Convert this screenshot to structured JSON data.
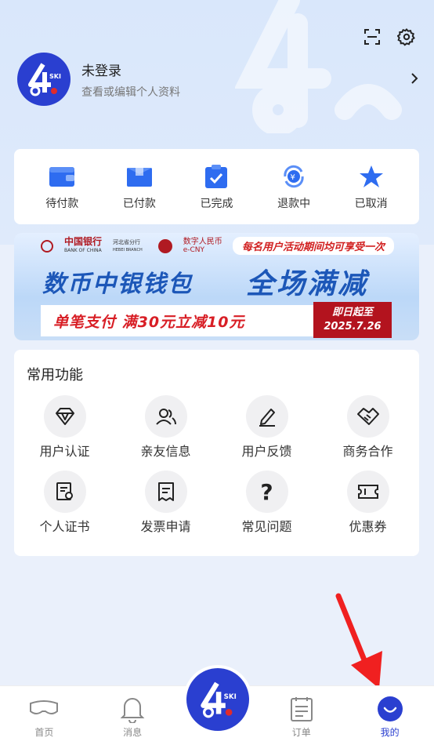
{
  "profile": {
    "name": "未登录",
    "subtitle": "查看或编辑个人资料"
  },
  "orders": [
    {
      "label": "待付款",
      "icon": "wallet-icon"
    },
    {
      "label": "已付款",
      "icon": "box-icon"
    },
    {
      "label": "已完成",
      "icon": "clipboard-check-icon"
    },
    {
      "label": "退款中",
      "icon": "refund-icon"
    },
    {
      "label": "已取消",
      "icon": "star-icon"
    }
  ],
  "banner": {
    "bank_cn": "中国银行",
    "bank_en": "BANK OF CHINA",
    "branch": "河北省分行",
    "branch_en": "HEBEI BRANCH",
    "ecny_cn": "数字人民币",
    "ecny_en": "e-CNY",
    "notice": "每名用户活动期间均可享受一次",
    "title_a": "数币中银钱包",
    "title_b": "全场满减",
    "offer": "单笔支付 满30元立减10元",
    "date_line1": "即日起至",
    "date_line2": "2025.7.26"
  },
  "functions": {
    "title": "常用功能",
    "items": [
      {
        "label": "用户认证",
        "icon": "diamond-icon"
      },
      {
        "label": "亲友信息",
        "icon": "users-icon"
      },
      {
        "label": "用户反馈",
        "icon": "pen-icon"
      },
      {
        "label": "商务合作",
        "icon": "handshake-icon"
      },
      {
        "label": "个人证书",
        "icon": "certificate-icon"
      },
      {
        "label": "发票申请",
        "icon": "receipt-icon"
      },
      {
        "label": "常见问题",
        "icon": "question-icon"
      },
      {
        "label": "优惠券",
        "icon": "coupon-icon"
      }
    ]
  },
  "tabbar": {
    "home": "首页",
    "messages": "消息",
    "orders": "订单",
    "mine": "我的"
  },
  "colors": {
    "brand": "#2a3fd0",
    "banner_red": "#d81e25",
    "banner_blue": "#1c57b8"
  }
}
